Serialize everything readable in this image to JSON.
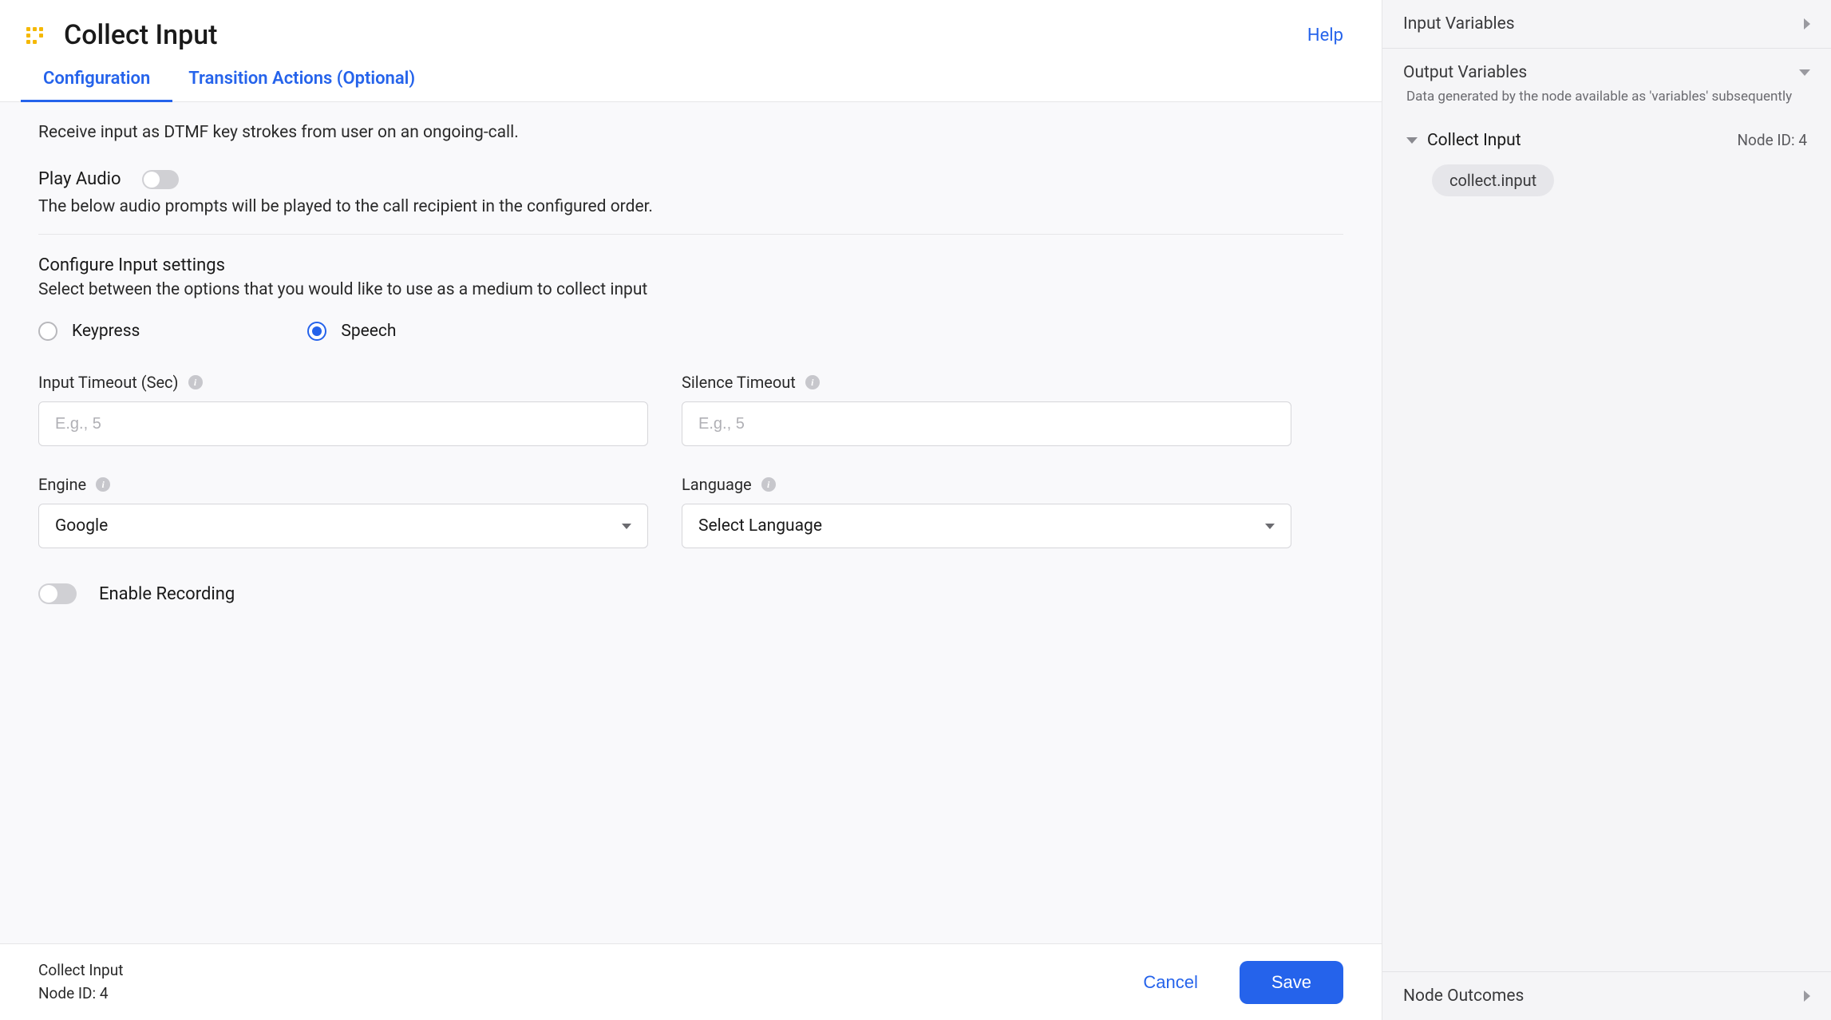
{
  "header": {
    "title": "Collect Input",
    "help_label": "Help"
  },
  "tabs": {
    "config": "Configuration",
    "transition": "Transition Actions (Optional)"
  },
  "content": {
    "description": "Receive input as DTMF key strokes from user on an ongoing-call.",
    "play_audio_label": "Play Audio",
    "play_audio_desc": "The below audio prompts will be played to the call recipient in the configured order.",
    "configure_title": "Configure Input settings",
    "configure_desc": "Select between the options that you would like to use as a medium to collect input",
    "radio_keypress": "Keypress",
    "radio_speech": "Speech",
    "fields": {
      "input_timeout_label": "Input Timeout (Sec)",
      "input_timeout_placeholder": "E.g., 5",
      "silence_timeout_label": "Silence Timeout",
      "silence_timeout_placeholder": "E.g., 5",
      "engine_label": "Engine",
      "engine_value": "Google",
      "language_label": "Language",
      "language_value": "Select Language"
    },
    "enable_recording_label": "Enable Recording"
  },
  "footer": {
    "meta_title": "Collect Input",
    "meta_id": "Node ID: 4",
    "cancel_label": "Cancel",
    "save_label": "Save"
  },
  "sidebar": {
    "input_vars_title": "Input Variables",
    "output_vars_title": "Output Variables",
    "output_vars_desc": "Data generated by the node available as 'variables' subsequently",
    "node_name": "Collect Input",
    "node_id": "Node ID: 4",
    "variable_pill": "collect.input",
    "node_outcomes_title": "Node Outcomes"
  }
}
